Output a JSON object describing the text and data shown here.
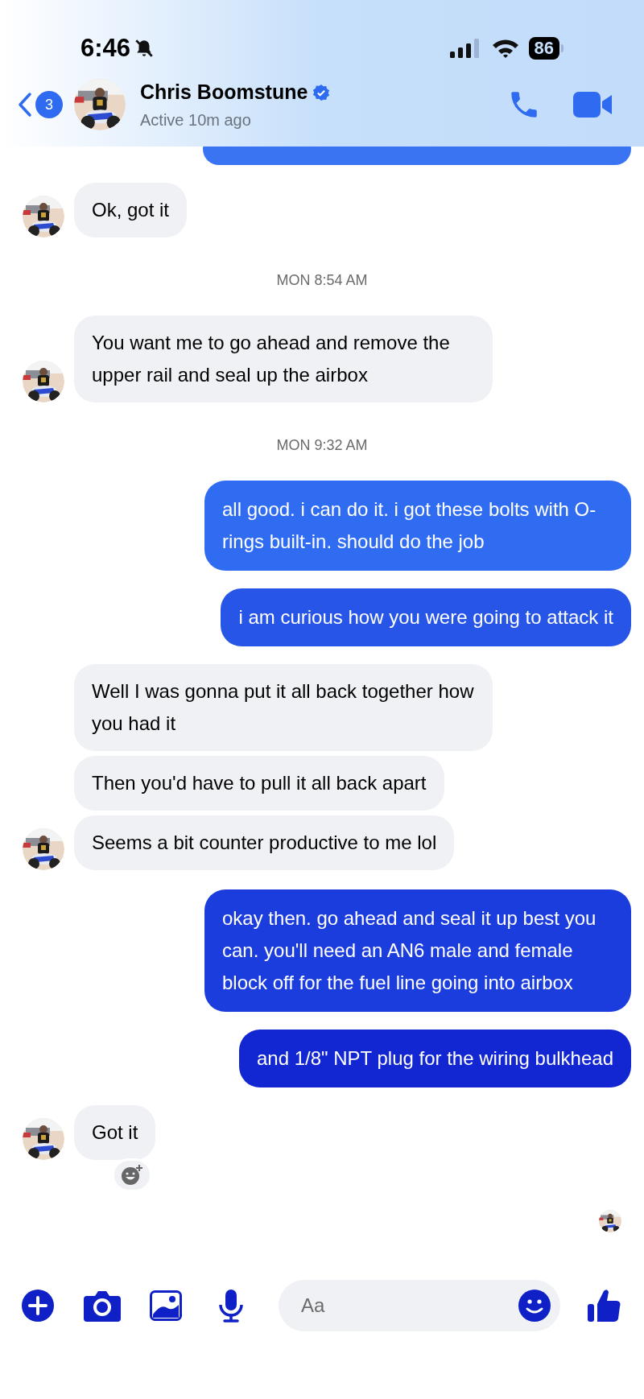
{
  "status_bar": {
    "time": "6:46",
    "muted": true,
    "battery": "86"
  },
  "header": {
    "unread_count": "3",
    "name": "Chris Boomstune",
    "verified": true,
    "subtitle": "Active 10m ago"
  },
  "messages": [
    {
      "kind": "covered"
    },
    {
      "kind": "received",
      "text": "Ok, got it",
      "avatar": true,
      "reaction_button": false
    },
    {
      "kind": "timestamp",
      "text": "MON 8:54 AM"
    },
    {
      "kind": "received",
      "text": "You want me to go ahead and remove the upper rail and seal up the airbox",
      "avatar": true,
      "reaction_button": false
    },
    {
      "kind": "timestamp",
      "text": "MON 9:32 AM"
    },
    {
      "kind": "sent",
      "text": "all good. i can do it. i got these bolts with O-rings built-in. should do the job"
    },
    {
      "kind": "sent",
      "text": "i am curious how you were going to attack it"
    },
    {
      "kind": "received",
      "text": "Well I was gonna put it all back together how you had it",
      "avatar": false,
      "reaction_button": false
    },
    {
      "kind": "received",
      "text": "Then you'd have to pull it all back apart",
      "avatar": false,
      "reaction_button": false
    },
    {
      "kind": "received",
      "text": "Seems a bit counter productive to me lol",
      "avatar": true,
      "reaction_button": false
    },
    {
      "kind": "sent",
      "text": "okay then. go ahead and seal it up best you can. you'll need an AN6 male and female block off for the fuel line going into airbox"
    },
    {
      "kind": "sent",
      "text": "and 1/8\" NPT plug for the wiring bulkhead"
    },
    {
      "kind": "received",
      "text": "Got it",
      "avatar": true,
      "reaction_button": true
    }
  ],
  "read_receipt": true,
  "composer": {
    "placeholder": "Aa"
  }
}
